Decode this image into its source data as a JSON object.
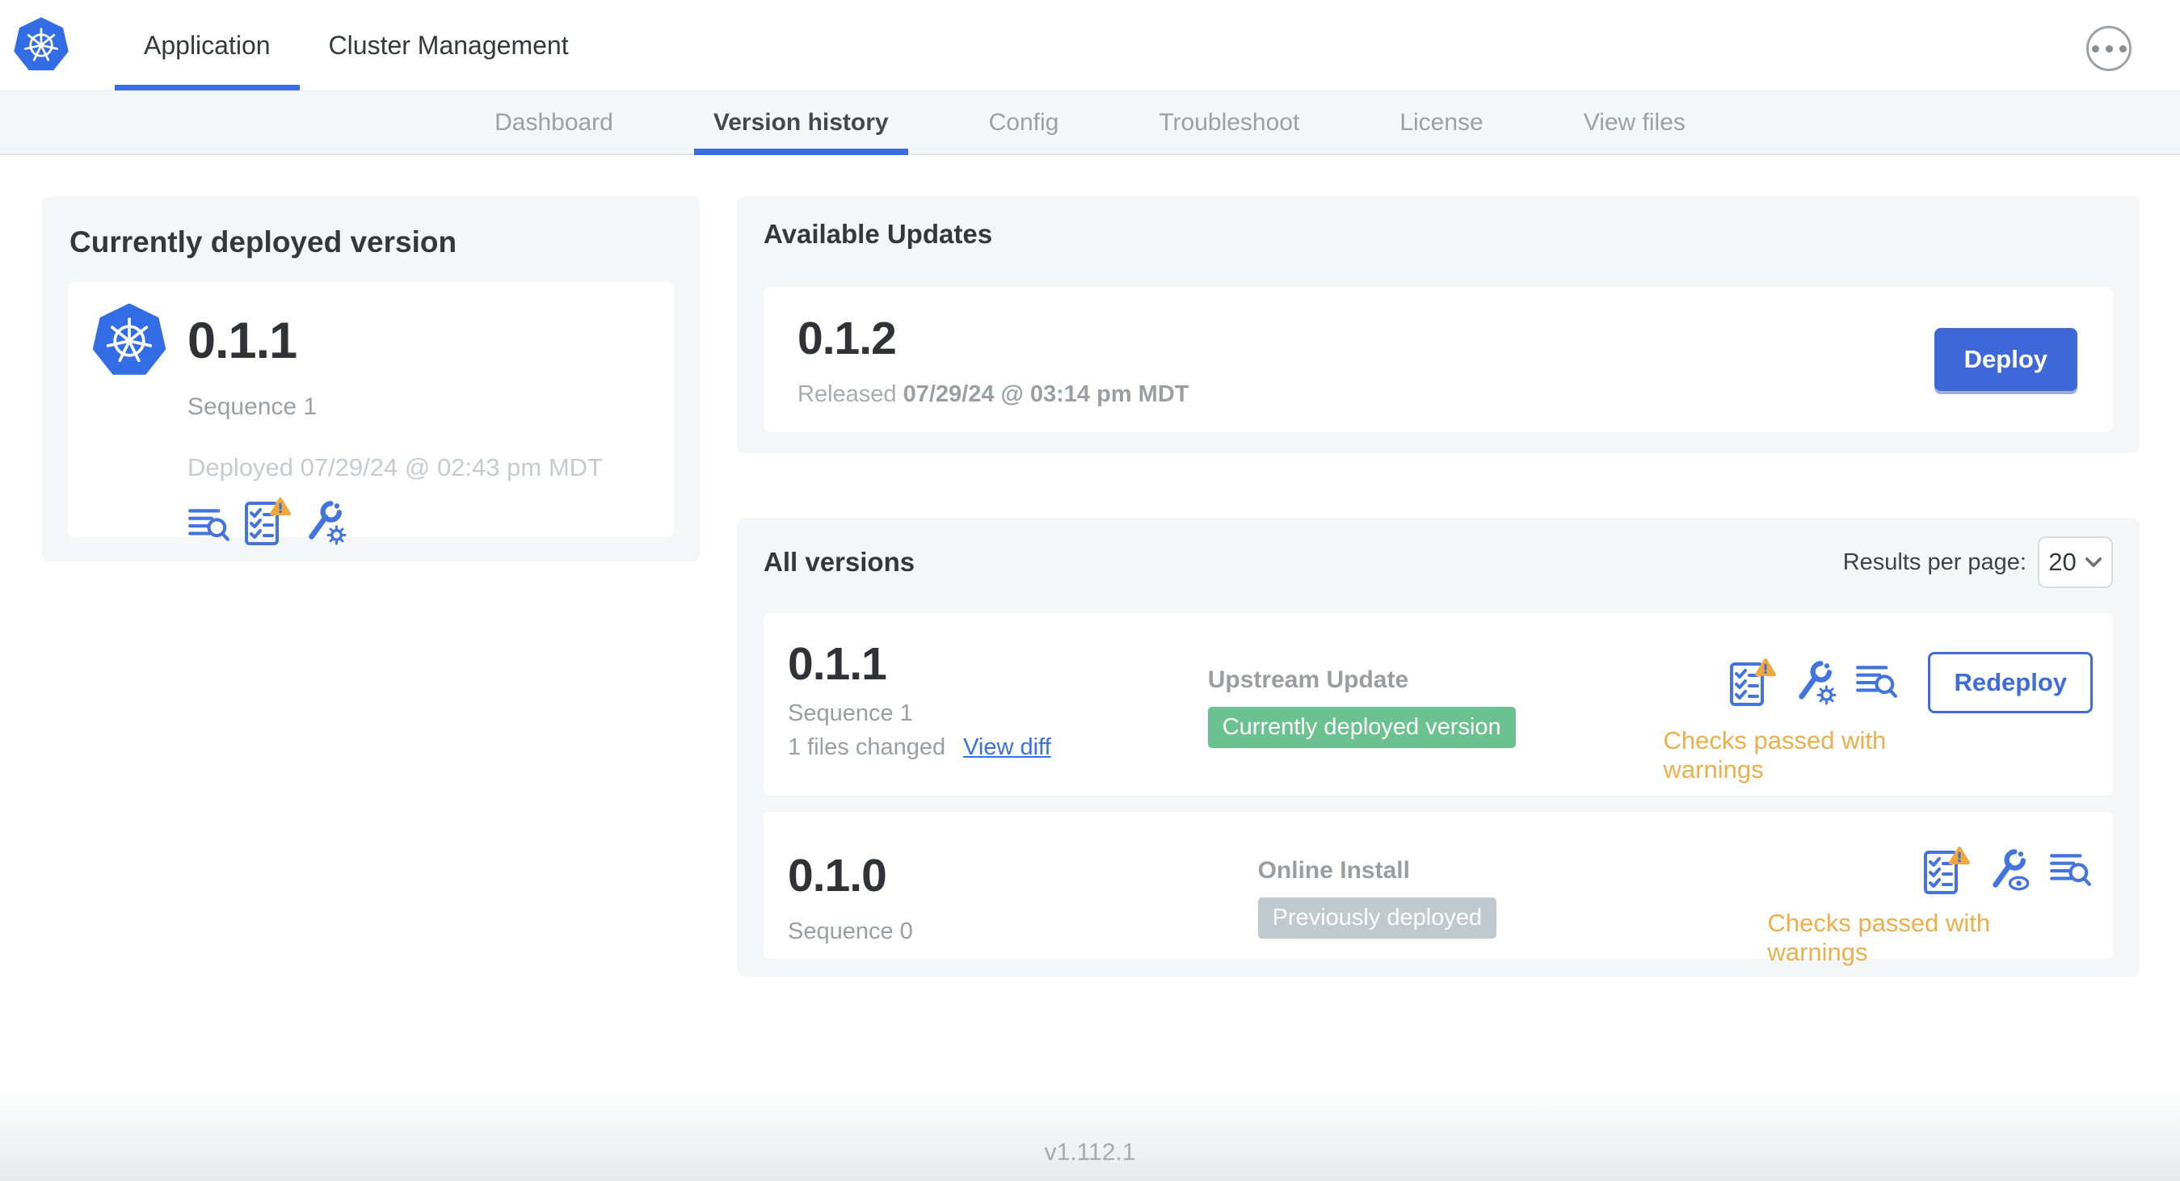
{
  "topbar": {
    "tabs": [
      {
        "label": "Application",
        "active": true
      },
      {
        "label": "Cluster Management",
        "active": false
      }
    ],
    "logo_icon": "kubernetes-logo",
    "menu_icon": "ellipsis-icon"
  },
  "subnav": {
    "items": [
      "Dashboard",
      "Version history",
      "Config",
      "Troubleshoot",
      "License",
      "View files"
    ],
    "active_item": "Version history"
  },
  "deployed_card": {
    "title": "Currently deployed version",
    "version": "0.1.1",
    "sequence": "Sequence 1",
    "deployed_at": "Deployed 07/29/24 @ 02:43 pm MDT",
    "icons": [
      "deploy-logs-icon",
      "preflight-checks-warning-icon",
      "edit-config-icon"
    ]
  },
  "available_updates": {
    "title": "Available Updates",
    "version": "0.1.2",
    "released_prefix": "Released",
    "released_at": "07/29/24 @ 03:14 pm MDT",
    "deploy_label": "Deploy"
  },
  "all_versions": {
    "title": "All versions",
    "results_per_page_label": "Results per page:",
    "results_per_page": "20",
    "rows": [
      {
        "version": "0.1.1",
        "sequence": "Sequence 1",
        "files_changed": "1 files changed",
        "diff_link": "View diff",
        "source": "Upstream Update",
        "badge": "Currently deployed version",
        "badge_style": "green",
        "status": "Checks passed with warnings",
        "action_label": "Redeploy",
        "icons": [
          "preflight-checks-warning-icon",
          "edit-config-icon",
          "deploy-logs-icon"
        ]
      },
      {
        "version": "0.1.0",
        "sequence": "Sequence 0",
        "source": "Online Install",
        "badge": "Previously deployed",
        "badge_style": "gray",
        "status": "Checks passed with warnings",
        "icons": [
          "preflight-checks-warning-icon",
          "view-config-icon",
          "deploy-logs-icon"
        ]
      }
    ]
  },
  "footer": {
    "app_version": "v1.112.1"
  },
  "colors": {
    "accent_blue": "#3e6cd8",
    "kubernetes_blue": "#326de6",
    "badge_green": "#6cc191",
    "badge_gray": "#c0c9cd",
    "warning_text": "#ecaf4c",
    "warning_triangle": "#f0a83c"
  }
}
